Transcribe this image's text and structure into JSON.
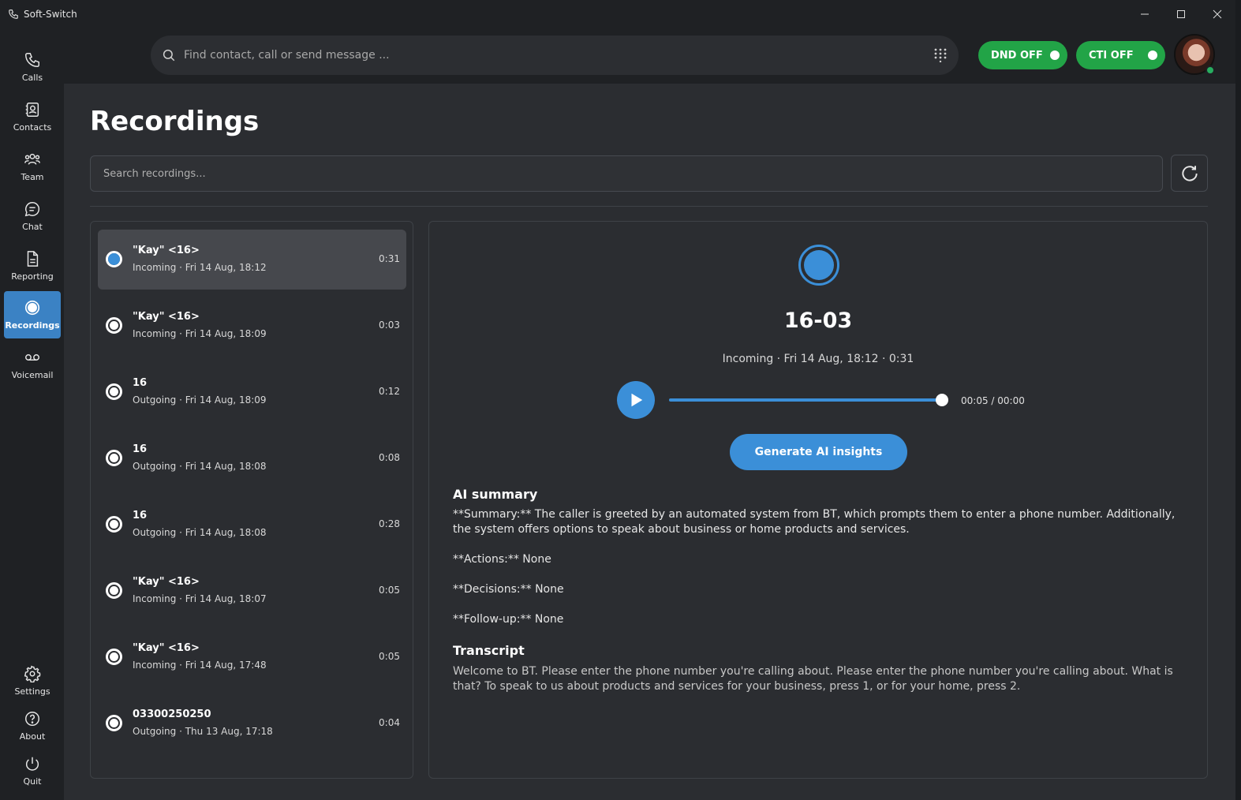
{
  "app": {
    "title": "Soft-Switch"
  },
  "sidebar": {
    "top_items": [
      {
        "label": "Calls",
        "icon": "phone-icon"
      },
      {
        "label": "Contacts",
        "icon": "contacts-icon"
      },
      {
        "label": "Team",
        "icon": "team-icon"
      },
      {
        "label": "Chat",
        "icon": "chat-icon"
      },
      {
        "label": "Reporting",
        "icon": "report-icon"
      },
      {
        "label": "Recordings",
        "icon": "record-icon",
        "active": true
      },
      {
        "label": "Voicemail",
        "icon": "voicemail-icon"
      }
    ],
    "bottom_items": [
      {
        "label": "Settings",
        "icon": "gear-icon"
      },
      {
        "label": "About",
        "icon": "help-icon"
      },
      {
        "label": "Quit",
        "icon": "power-icon"
      }
    ]
  },
  "topbar": {
    "search_placeholder": "Find contact, call or send message ...",
    "dnd_label": "DND OFF",
    "cti_label": "CTI OFF"
  },
  "page": {
    "title": "Recordings",
    "search_placeholder": "Search recordings..."
  },
  "recordings": [
    {
      "name": "\"Kay\" <16>",
      "meta": "Incoming · Fri 14 Aug, 18:12",
      "duration": "0:31",
      "selected": true
    },
    {
      "name": "\"Kay\" <16>",
      "meta": "Incoming · Fri 14 Aug, 18:09",
      "duration": "0:03"
    },
    {
      "name": "16",
      "meta": "Outgoing · Fri 14 Aug, 18:09",
      "duration": "0:12"
    },
    {
      "name": "16",
      "meta": "Outgoing · Fri 14 Aug, 18:08",
      "duration": "0:08"
    },
    {
      "name": "16",
      "meta": "Outgoing · Fri 14 Aug, 18:08",
      "duration": "0:28"
    },
    {
      "name": "\"Kay\" <16>",
      "meta": "Incoming · Fri 14 Aug, 18:07",
      "duration": "0:05"
    },
    {
      "name": "\"Kay\" <16>",
      "meta": "Incoming · Fri 14 Aug, 17:48",
      "duration": "0:05"
    },
    {
      "name": "03300250250",
      "meta": "Outgoing · Thu 13 Aug, 17:18",
      "duration": "0:04"
    }
  ],
  "detail": {
    "title": "16-03",
    "meta": "Incoming · Fri 14 Aug, 18:12 · 0:31",
    "time": "00:05 / 00:00",
    "progress_fraction": 1.0,
    "ai_button": "Generate AI insights",
    "summary_heading": "AI summary",
    "summary": "**Summary:** The caller is greeted by an automated system from BT, which prompts them to enter a phone number. Additionally, the system offers options to speak about business or home products and services.",
    "actions": "**Actions:** None",
    "decisions": "**Decisions:** None",
    "followup": "**Follow-up:** None",
    "transcript_heading": "Transcript",
    "transcript": "Welcome to BT. Please enter the phone number you're calling about. Please enter the phone number you're calling about. What is that? To speak to us about products and services for your business, press 1, or for your home, press 2."
  },
  "colors": {
    "accent": "#3b8fd8",
    "toggle_green": "#22a447",
    "background": "#2b2d31",
    "chrome": "#1f2124"
  }
}
